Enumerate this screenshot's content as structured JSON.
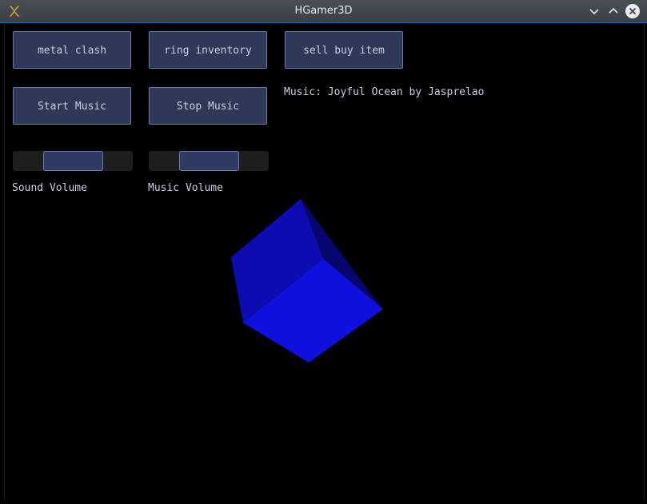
{
  "window": {
    "title": "HGamer3D",
    "icons": {
      "app": "hgamer3d-logo-icon",
      "minimize": "chevron-down-icon",
      "maximize": "chevron-up-icon",
      "close": "close-icon"
    }
  },
  "buttons": {
    "metal_clash": "metal clash",
    "ring_inventory": "ring inventory",
    "sell_buy_item": "sell buy item",
    "start_music": "Start Music",
    "stop_music": "Stop Music"
  },
  "music_info": "Music: Joyful Ocean by Jasprelao",
  "sound_volume": {
    "label": "Sound Volume",
    "level": 0.5
  },
  "music_volume": {
    "label": "Music Volume",
    "level": 0.5
  },
  "colors": {
    "button_bg": "#2f3856",
    "button_border": "#6b79b1",
    "text": "#c9cde0",
    "cube_front": "#1010dc",
    "cube_left": "#0c0cb0",
    "cube_back": "#06066e"
  }
}
